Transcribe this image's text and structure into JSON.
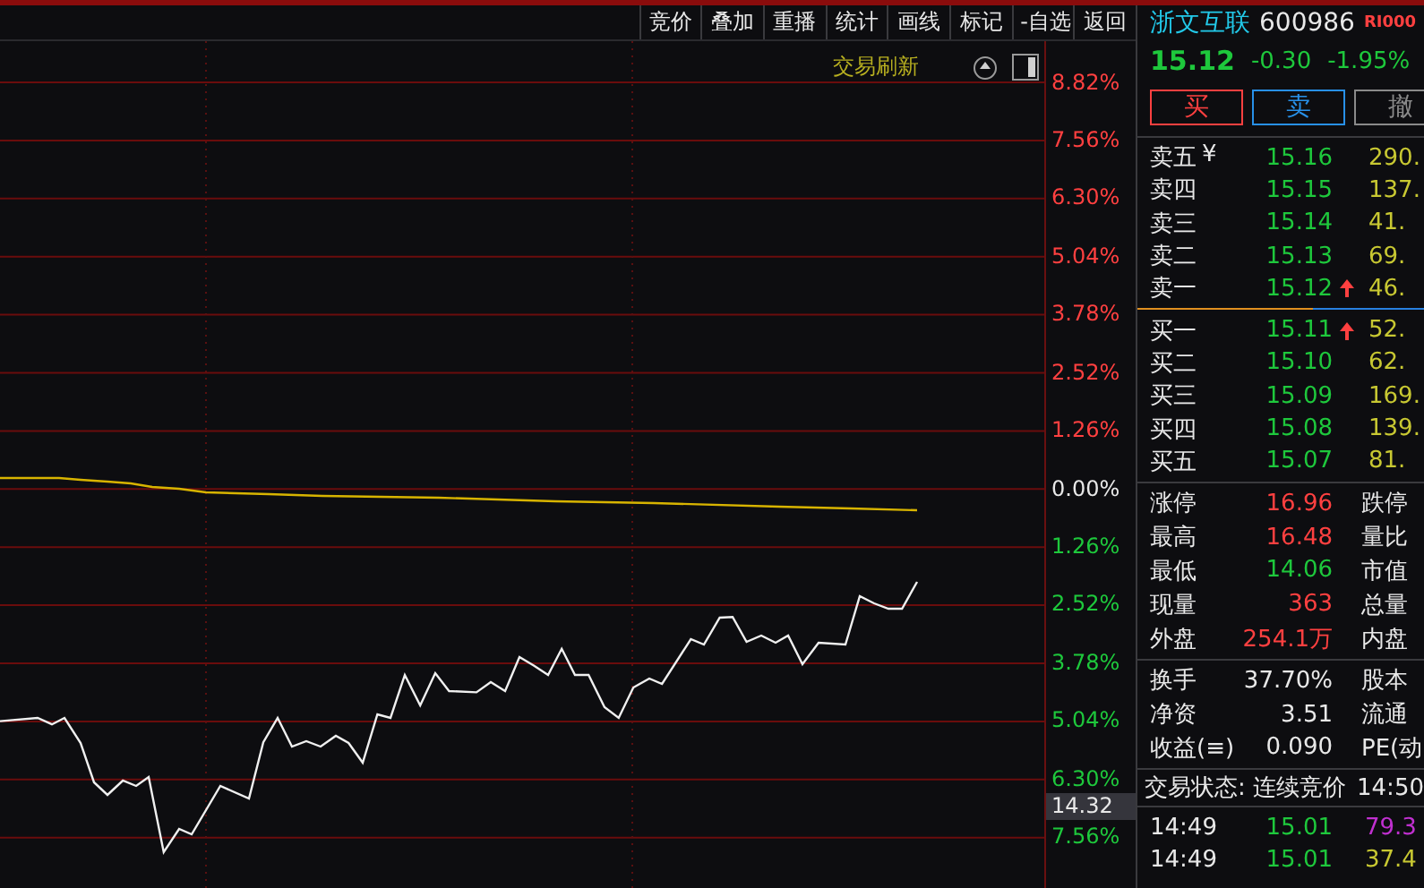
{
  "toolbar": {
    "buttons": [
      "竞价",
      "叠加",
      "重播",
      "统计",
      "画线",
      "标记",
      "-自选",
      "返回"
    ]
  },
  "chart_header": {
    "label": "交易刷新"
  },
  "axis_labels": [
    {
      "text": "8.82%",
      "kind": "up"
    },
    {
      "text": "7.56%",
      "kind": "up"
    },
    {
      "text": "6.30%",
      "kind": "up"
    },
    {
      "text": "5.04%",
      "kind": "up"
    },
    {
      "text": "3.78%",
      "kind": "up"
    },
    {
      "text": "2.52%",
      "kind": "up"
    },
    {
      "text": "1.26%",
      "kind": "up"
    },
    {
      "text": "0.00%",
      "kind": "flat"
    },
    {
      "text": "1.26%",
      "kind": "down"
    },
    {
      "text": "2.52%",
      "kind": "down"
    },
    {
      "text": "3.78%",
      "kind": "down"
    },
    {
      "text": "5.04%",
      "kind": "down"
    },
    {
      "text": "6.30%",
      "kind": "down"
    },
    {
      "text": "7.56%",
      "kind": "down"
    }
  ],
  "crosshair_value": "14.32",
  "quote": {
    "name": "浙文互联",
    "code": "600986",
    "tag": "RI000",
    "price": "15.12",
    "change": "-0.30",
    "change_pct": "-1.95%"
  },
  "trade_buttons": [
    {
      "label": "买",
      "kind": "buy"
    },
    {
      "label": "卖",
      "kind": "sell"
    },
    {
      "label": "撤",
      "kind": "cancel"
    }
  ],
  "order_book": {
    "asks": [
      {
        "label": "卖五",
        "marker": "¥",
        "price": "15.16",
        "volume": "290.",
        "up_arrow": false
      },
      {
        "label": "卖四",
        "price": "15.15",
        "volume": "137.",
        "up_arrow": false
      },
      {
        "label": "卖三",
        "price": "15.14",
        "volume": "41.",
        "up_arrow": false
      },
      {
        "label": "卖二",
        "price": "15.13",
        "volume": "69.",
        "up_arrow": false
      },
      {
        "label": "卖一",
        "price": "15.12",
        "volume": "46.",
        "up_arrow": true
      }
    ],
    "bids": [
      {
        "label": "买一",
        "price": "15.11",
        "volume": "52.",
        "up_arrow": true
      },
      {
        "label": "买二",
        "price": "15.10",
        "volume": "62.",
        "up_arrow": false
      },
      {
        "label": "买三",
        "price": "15.09",
        "volume": "169.",
        "up_arrow": false
      },
      {
        "label": "买四",
        "price": "15.08",
        "volume": "139.",
        "up_arrow": false
      },
      {
        "label": "买五",
        "price": "15.07",
        "volume": "81.",
        "up_arrow": false
      }
    ]
  },
  "stats": [
    {
      "label": "涨停",
      "value": "16.96",
      "color": "#ff4040",
      "label_2": "跌停"
    },
    {
      "label": "最高",
      "value": "16.48",
      "color": "#ff4040",
      "label_2": "量比"
    },
    {
      "label": "最低",
      "value": "14.06",
      "color": "#1ec83c",
      "label_2": "市值"
    },
    {
      "label": "现量",
      "value": "363",
      "color": "#ff4040",
      "label_2": "总量"
    },
    {
      "label": "外盘",
      "value": "254.1万",
      "color": "#ff4040",
      "label_2": "内盘"
    }
  ],
  "stats_2": [
    {
      "label": "换手",
      "value": "37.70%",
      "label_2": "股本"
    },
    {
      "label": "净资",
      "value": "3.51",
      "label_2": "流通"
    },
    {
      "label": "收益(≡)",
      "value": "0.090",
      "label_2": "PE(动"
    }
  ],
  "trade_status": {
    "label": "交易状态: 连续竞价",
    "time": "14:50"
  },
  "ticks": [
    {
      "time": "14:49",
      "price": "15.01",
      "volume": "79.3",
      "color": "#c030d0"
    },
    {
      "time": "14:49",
      "price": "15.01",
      "volume": "37.4",
      "color": "#c8c832"
    }
  ]
}
